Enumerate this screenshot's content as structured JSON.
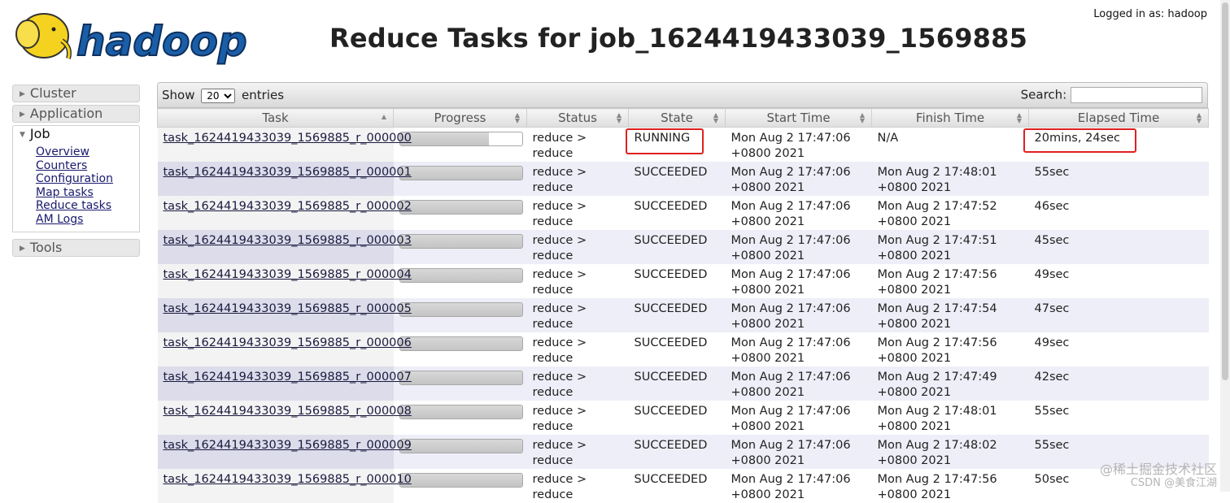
{
  "header": {
    "logo_text": "hadoop",
    "logged_in": "Logged in as: hadoop",
    "title": "Reduce Tasks for job_1624419433039_1569885"
  },
  "sidebar": {
    "cluster": "Cluster",
    "application": "Application",
    "job": "Job",
    "job_links": [
      "Overview",
      "Counters",
      "Configuration",
      "Map tasks",
      "Reduce tasks",
      "AM Logs"
    ],
    "tools": "Tools"
  },
  "table_controls": {
    "show_label": "Show",
    "page_size": "20",
    "entries_label": "entries",
    "search_label": "Search:"
  },
  "columns": [
    "Task",
    "Progress",
    "Status",
    "State",
    "Start Time",
    "Finish Time",
    "Elapsed Time"
  ],
  "rows": [
    {
      "task": "task_1624419433039_1569885_r_000000",
      "progress": 0.73,
      "status1": "reduce >",
      "status2": "reduce",
      "state": "RUNNING",
      "start1": "Mon Aug 2 17:47:06",
      "start2": "+0800 2021",
      "finish1": "N/A",
      "finish2": "",
      "elapsed": "20mins, 24sec"
    },
    {
      "task": "task_1624419433039_1569885_r_000001",
      "progress": 1.0,
      "status1": "reduce >",
      "status2": "reduce",
      "state": "SUCCEEDED",
      "start1": "Mon Aug 2 17:47:06",
      "start2": "+0800 2021",
      "finish1": "Mon Aug 2 17:48:01",
      "finish2": "+0800 2021",
      "elapsed": "55sec"
    },
    {
      "task": "task_1624419433039_1569885_r_000002",
      "progress": 1.0,
      "status1": "reduce >",
      "status2": "reduce",
      "state": "SUCCEEDED",
      "start1": "Mon Aug 2 17:47:06",
      "start2": "+0800 2021",
      "finish1": "Mon Aug 2 17:47:52",
      "finish2": "+0800 2021",
      "elapsed": "46sec"
    },
    {
      "task": "task_1624419433039_1569885_r_000003",
      "progress": 1.0,
      "status1": "reduce >",
      "status2": "reduce",
      "state": "SUCCEEDED",
      "start1": "Mon Aug 2 17:47:06",
      "start2": "+0800 2021",
      "finish1": "Mon Aug 2 17:47:51",
      "finish2": "+0800 2021",
      "elapsed": "45sec"
    },
    {
      "task": "task_1624419433039_1569885_r_000004",
      "progress": 1.0,
      "status1": "reduce >",
      "status2": "reduce",
      "state": "SUCCEEDED",
      "start1": "Mon Aug 2 17:47:06",
      "start2": "+0800 2021",
      "finish1": "Mon Aug 2 17:47:56",
      "finish2": "+0800 2021",
      "elapsed": "49sec"
    },
    {
      "task": "task_1624419433039_1569885_r_000005",
      "progress": 1.0,
      "status1": "reduce >",
      "status2": "reduce",
      "state": "SUCCEEDED",
      "start1": "Mon Aug 2 17:47:06",
      "start2": "+0800 2021",
      "finish1": "Mon Aug 2 17:47:54",
      "finish2": "+0800 2021",
      "elapsed": "47sec"
    },
    {
      "task": "task_1624419433039_1569885_r_000006",
      "progress": 1.0,
      "status1": "reduce >",
      "status2": "reduce",
      "state": "SUCCEEDED",
      "start1": "Mon Aug 2 17:47:06",
      "start2": "+0800 2021",
      "finish1": "Mon Aug 2 17:47:56",
      "finish2": "+0800 2021",
      "elapsed": "49sec"
    },
    {
      "task": "task_1624419433039_1569885_r_000007",
      "progress": 1.0,
      "status1": "reduce >",
      "status2": "reduce",
      "state": "SUCCEEDED",
      "start1": "Mon Aug 2 17:47:06",
      "start2": "+0800 2021",
      "finish1": "Mon Aug 2 17:47:49",
      "finish2": "+0800 2021",
      "elapsed": "42sec"
    },
    {
      "task": "task_1624419433039_1569885_r_000008",
      "progress": 1.0,
      "status1": "reduce >",
      "status2": "reduce",
      "state": "SUCCEEDED",
      "start1": "Mon Aug 2 17:47:06",
      "start2": "+0800 2021",
      "finish1": "Mon Aug 2 17:48:01",
      "finish2": "+0800 2021",
      "elapsed": "55sec"
    },
    {
      "task": "task_1624419433039_1569885_r_000009",
      "progress": 1.0,
      "status1": "reduce >",
      "status2": "reduce",
      "state": "SUCCEEDED",
      "start1": "Mon Aug 2 17:47:06",
      "start2": "+0800 2021",
      "finish1": "Mon Aug 2 17:48:02",
      "finish2": "+0800 2021",
      "elapsed": "55sec"
    },
    {
      "task": "task_1624419433039_1569885_r_000010",
      "progress": 1.0,
      "status1": "reduce >",
      "status2": "reduce",
      "state": "SUCCEEDED",
      "start1": "Mon Aug 2 17:47:06",
      "start2": "+0800 2021",
      "finish1": "Mon Aug 2 17:47:56",
      "finish2": "+0800 2021",
      "elapsed": "50sec"
    }
  ],
  "watermark": {
    "line1": "@稀土掘金技术社区",
    "line2": "CSDN @美食江湖"
  },
  "colors": {
    "highlight": "#e02020",
    "logo_blue": "#1b5ea8",
    "logo_yellow": "#f5d21f"
  }
}
